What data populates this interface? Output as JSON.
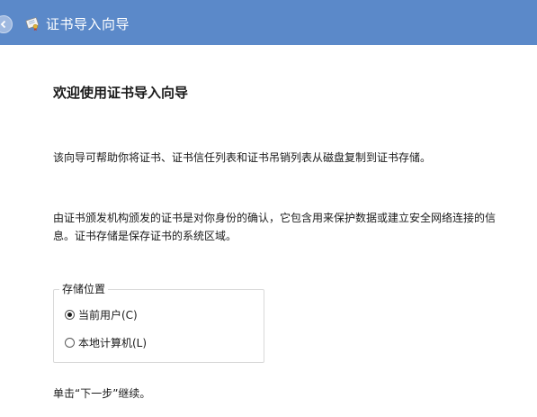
{
  "window": {
    "title": "证书导入向导",
    "accent_color": "#5b89c9"
  },
  "icons": {
    "back": "back-arrow-icon",
    "title": "certificate-icon"
  },
  "main": {
    "heading": "欢迎使用证书导入向导",
    "paragraph1": "该向导可帮助你将证书、证书信任列表和证书吊销列表从磁盘复制到证书存储。",
    "paragraph2": "由证书颁发机构颁发的证书是对你身份的确认，它包含用来保护数据或建立安全网络连接的信息。证书存储是保存证书的系统区域。",
    "store_location": {
      "label": "存储位置",
      "options": [
        {
          "label": "当前用户(C)",
          "checked": true
        },
        {
          "label": "本地计算机(L)",
          "checked": false
        }
      ]
    },
    "continue_hint": "单击“下一步”继续。"
  }
}
